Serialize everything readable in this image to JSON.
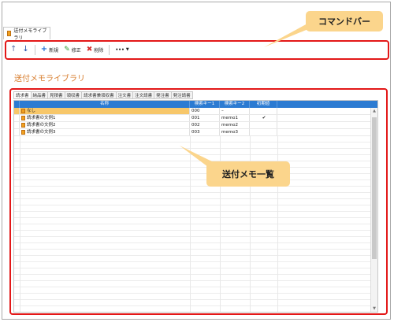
{
  "window": {
    "tab_title": "送付メモライブラリ"
  },
  "toolbar": {
    "new_label": "新規",
    "edit_label": "修正",
    "delete_label": "削除",
    "more_label": "•••"
  },
  "page": {
    "heading": "送付メモライブラリ"
  },
  "tabs": [
    "請求書",
    "納品書",
    "見積書",
    "領収書",
    "請求書兼領収書",
    "注文書",
    "注文請書",
    "発注書",
    "発注請書"
  ],
  "grid": {
    "columns": [
      "名称",
      "検索キー1",
      "検索キー2",
      "初期値"
    ],
    "rows": [
      {
        "name": "なし",
        "key1": "000",
        "key2": "–",
        "default": ""
      },
      {
        "name": "請求書の文例1",
        "key1": "001",
        "key2": "memo1",
        "default": "✔"
      },
      {
        "name": "請求書の文例2",
        "key1": "002",
        "key2": "memo2",
        "default": ""
      },
      {
        "name": "請求書の文例3",
        "key1": "003",
        "key2": "memo3",
        "default": ""
      }
    ]
  },
  "callouts": {
    "command_bar": "コマンドバー",
    "memo_list": "送付メモ一覧"
  },
  "colors": {
    "accent": "#e31818",
    "header": "#2c7bd2",
    "callout": "#fbd58c",
    "heading": "#d77b2a"
  }
}
